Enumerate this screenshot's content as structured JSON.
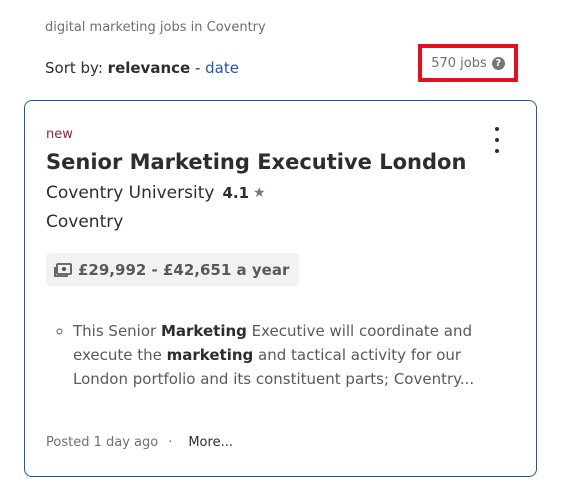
{
  "breadcrumb": "digital marketing jobs in Coventry",
  "sort": {
    "label": "Sort by:",
    "active": "relevance",
    "separator": " - ",
    "alternate": "date"
  },
  "job_count": "570 jobs",
  "help_icon_glyph": "?",
  "job": {
    "badge": "new",
    "title": "Senior Marketing Executive London",
    "company": "Coventry University",
    "rating": "4.1",
    "rating_star": "★",
    "location": "Coventry",
    "salary": "£29,992 - £42,651 a year",
    "snippet": {
      "p1": "This Senior ",
      "b1": "Marketing",
      "p2": " Executive will coordinate and execute the ",
      "b2": "marketing",
      "p3": " and tactical activity for our London portfolio and its constituent parts; Coventry..."
    },
    "posted": "Posted 1 day ago",
    "dot": "·",
    "more": "More..."
  },
  "icons": [
    "help-icon",
    "star-icon",
    "money-icon",
    "kebab-menu-icon"
  ],
  "colors": {
    "link": "#2557a7",
    "highlight_box": "#e3111f",
    "new_badge": "#8f2437",
    "card_border": "#2557a7"
  }
}
